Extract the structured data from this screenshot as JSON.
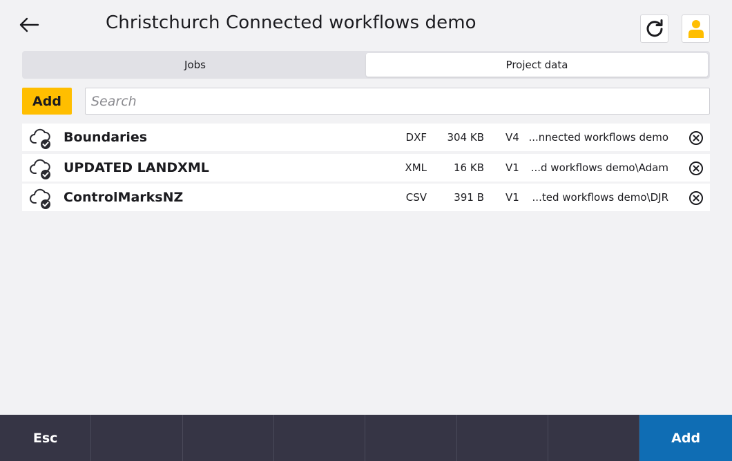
{
  "header": {
    "title": "Christchurch Connected workflows demo",
    "back_icon": "arrow-left-icon",
    "refresh_icon": "refresh-icon",
    "user_icon": "user-icon",
    "user_icon_color": "#ffbe00"
  },
  "tabs": [
    {
      "label": "Jobs",
      "active": false
    },
    {
      "label": "Project data",
      "active": true
    }
  ],
  "toolbar": {
    "add_label": "Add",
    "search_placeholder": "Search",
    "accent": "#ffbe00"
  },
  "files": [
    {
      "name": "Boundaries",
      "type": "DXF",
      "size": "304 KB",
      "version": "V4",
      "path": "...nnected workflows demo",
      "status_icon": "cloud-synced-icon"
    },
    {
      "name": "UPDATED LANDXML",
      "type": "XML",
      "size": "16 KB",
      "version": "V1",
      "path": "...d workflows demo\\Adam",
      "status_icon": "cloud-synced-icon"
    },
    {
      "name": "ControlMarksNZ",
      "type": "CSV",
      "size": "391 B",
      "version": "V1",
      "path": "...ted workflows demo\\DJR",
      "status_icon": "cloud-synced-icon"
    }
  ],
  "softkeys": [
    {
      "label": "Esc"
    },
    {
      "label": ""
    },
    {
      "label": ""
    },
    {
      "label": ""
    },
    {
      "label": ""
    },
    {
      "label": ""
    },
    {
      "label": ""
    },
    {
      "label": "Add",
      "primary": true
    }
  ],
  "colors": {
    "background": "#f2f2f4",
    "softkey_bar": "#363545",
    "primary_button": "#0f6db4"
  }
}
